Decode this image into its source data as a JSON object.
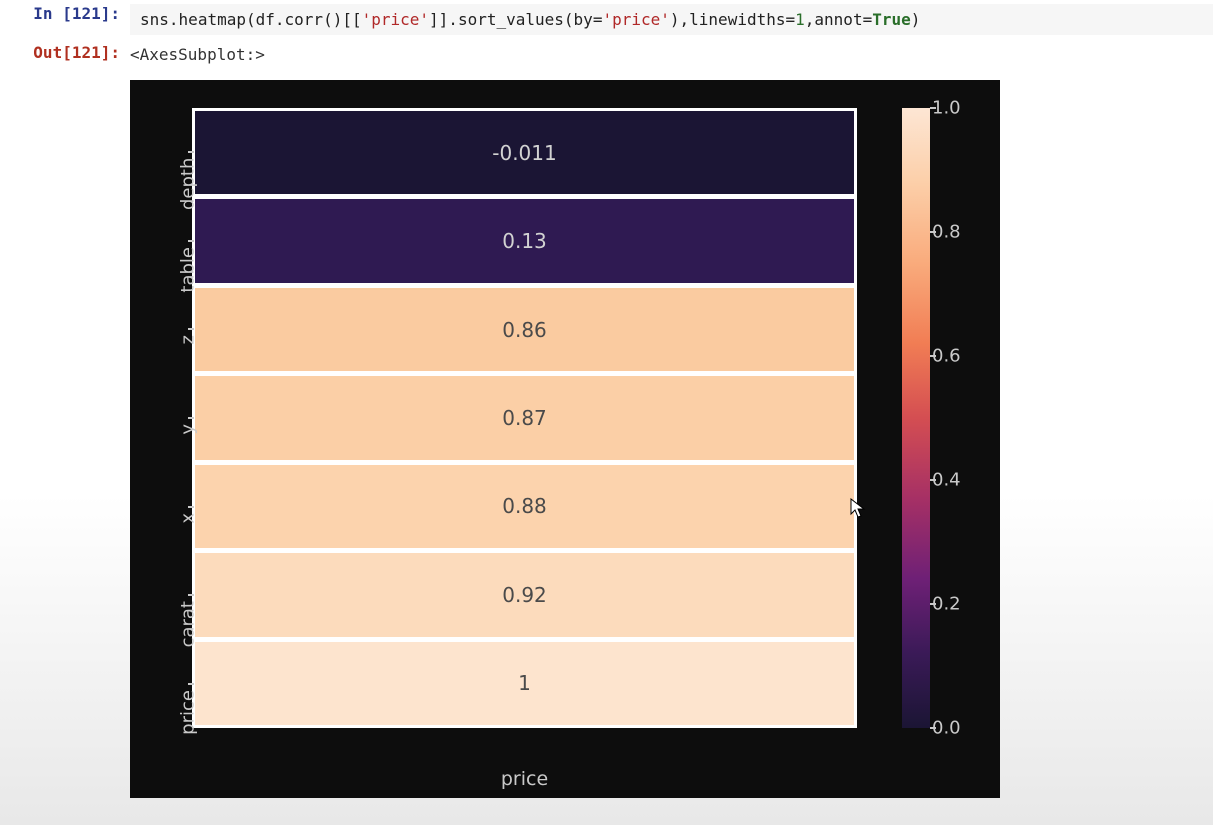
{
  "input_prompt": "In [121]:",
  "output_prompt": "Out[121]:",
  "code_tokens": [
    {
      "t": "sns",
      "c": "s-name"
    },
    {
      "t": ".",
      "c": "s-name"
    },
    {
      "t": "heatmap",
      "c": "s-name"
    },
    {
      "t": "(",
      "c": "s-name"
    },
    {
      "t": "df",
      "c": "s-name"
    },
    {
      "t": ".",
      "c": "s-name"
    },
    {
      "t": "corr",
      "c": "s-name"
    },
    {
      "t": "()[[",
      "c": "s-name"
    },
    {
      "t": "'price'",
      "c": "s-str"
    },
    {
      "t": "]].",
      "c": "s-name"
    },
    {
      "t": "sort_values",
      "c": "s-name"
    },
    {
      "t": "(",
      "c": "s-name"
    },
    {
      "t": "by",
      "c": "s-name"
    },
    {
      "t": "=",
      "c": "s-name"
    },
    {
      "t": "'price'",
      "c": "s-str"
    },
    {
      "t": "),",
      "c": "s-name"
    },
    {
      "t": "linewidths",
      "c": "s-name"
    },
    {
      "t": "=",
      "c": "s-name"
    },
    {
      "t": "1",
      "c": "s-num"
    },
    {
      "t": ",",
      "c": "s-name"
    },
    {
      "t": "annot",
      "c": "s-name"
    },
    {
      "t": "=",
      "c": "s-name"
    },
    {
      "t": "True",
      "c": "s-kw"
    },
    {
      "t": ")",
      "c": "s-name"
    }
  ],
  "output_repr": "<AxesSubplot:>",
  "chart_data": {
    "type": "heatmap",
    "xlabel": "price",
    "ylabels": [
      "depth",
      "table",
      "z",
      "y",
      "x",
      "carat",
      "price"
    ],
    "values": [
      -0.011,
      0.13,
      0.86,
      0.87,
      0.88,
      0.92,
      1
    ],
    "annotations": [
      "-0.011",
      "0.13",
      "0.86",
      "0.87",
      "0.88",
      "0.92",
      "1"
    ],
    "cell_colors": [
      "#1b1534",
      "#2f1a52",
      "#facba0",
      "#fbcfa6",
      "#fcd3ad",
      "#fcdbbc",
      "#fde4ce"
    ],
    "annot_text_colors": [
      "light",
      "light",
      "dark",
      "dark",
      "dark",
      "dark",
      "dark"
    ],
    "colorbar_ticks": [
      {
        "label": "1.0",
        "pos": 0.0
      },
      {
        "label": "0.8",
        "pos": 0.2
      },
      {
        "label": "0.6",
        "pos": 0.4
      },
      {
        "label": "0.4",
        "pos": 0.6
      },
      {
        "label": "0.2",
        "pos": 0.8
      },
      {
        "label": "0.0",
        "pos": 1.0
      }
    ],
    "vmin": 0.0,
    "vmax": 1.0
  }
}
